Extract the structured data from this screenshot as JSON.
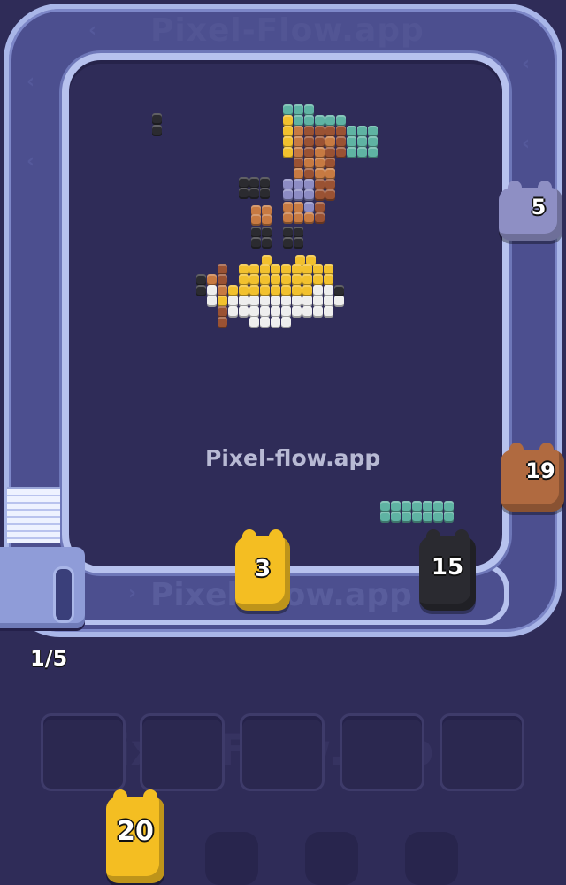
{
  "watermarks": {
    "top": "Pixel-Flow.app",
    "center": "Pixel-flow.app",
    "conveyor": "Pixel-Flow.app",
    "slots": "Pixel-Flow.app"
  },
  "queue_counter": "1/5",
  "shooters_on_track": [
    {
      "count": "5",
      "color": "#8e8fc4"
    },
    {
      "count": "19",
      "color": "#b06a40"
    },
    {
      "count": "3",
      "color": "#f4be22"
    },
    {
      "count": "15",
      "color": "#2a2a30"
    }
  ],
  "queue_shooter": {
    "count": "20",
    "color": "#f4be22"
  },
  "slots_total": 5,
  "colors": {
    "teal": "#5fb3a3",
    "brown": "#9a5233",
    "orange": "#c77a42",
    "yellow": "#f2c12e",
    "white": "#eeeeee",
    "black": "#2b2b30",
    "lavender": "#8d8cc4",
    "background": "#2f2c58",
    "track": "#b7c2ee"
  }
}
